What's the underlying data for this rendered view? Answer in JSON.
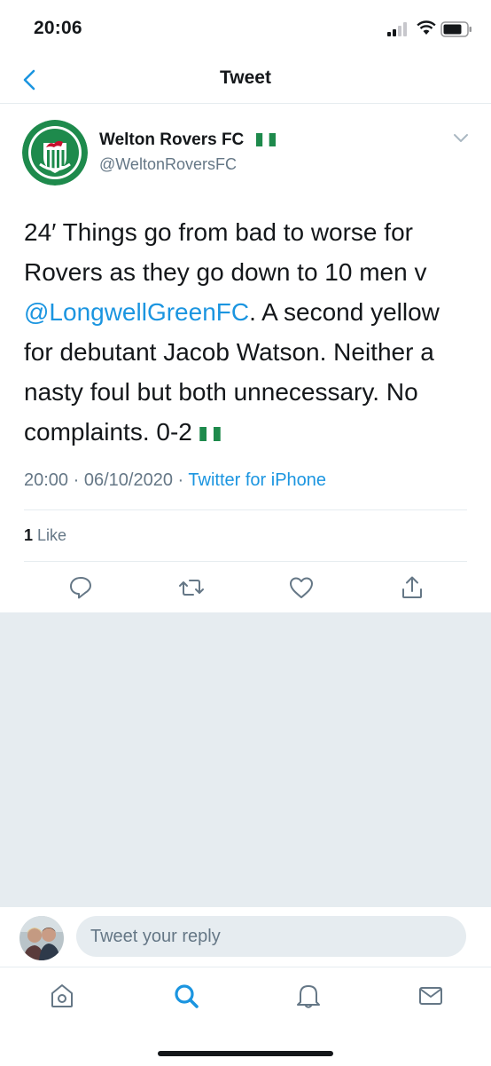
{
  "status_bar": {
    "time": "20:06"
  },
  "nav": {
    "title": "Tweet"
  },
  "tweet": {
    "author_name": "Welton Rovers FC",
    "author_handle": "@WeltonRoversFC",
    "text_part1": "24′ Things go from bad to worse for Rovers as they go down to 10 men v ",
    "mention": "@LongwellGreenFC",
    "text_part2": ". A second yellow for debutant Jacob Watson. Neither a nasty foul but both unnecessary. No complaints. 0-2",
    "time": "20:00",
    "date": "06/10/2020",
    "separator": "·",
    "source": "Twitter for iPhone",
    "like_count": "1",
    "like_label": "Like"
  },
  "reply": {
    "placeholder": "Tweet your reply"
  },
  "colors": {
    "accent": "#1b95e0",
    "secondary_text": "#657786",
    "divider": "#e6ecf0",
    "club_green": "#1e8a4c"
  },
  "icons": {
    "actions": [
      "reply-icon",
      "retweet-icon",
      "like-icon",
      "share-icon"
    ],
    "tabs": [
      "home-icon",
      "search-icon",
      "notifications-icon",
      "messages-icon"
    ]
  }
}
